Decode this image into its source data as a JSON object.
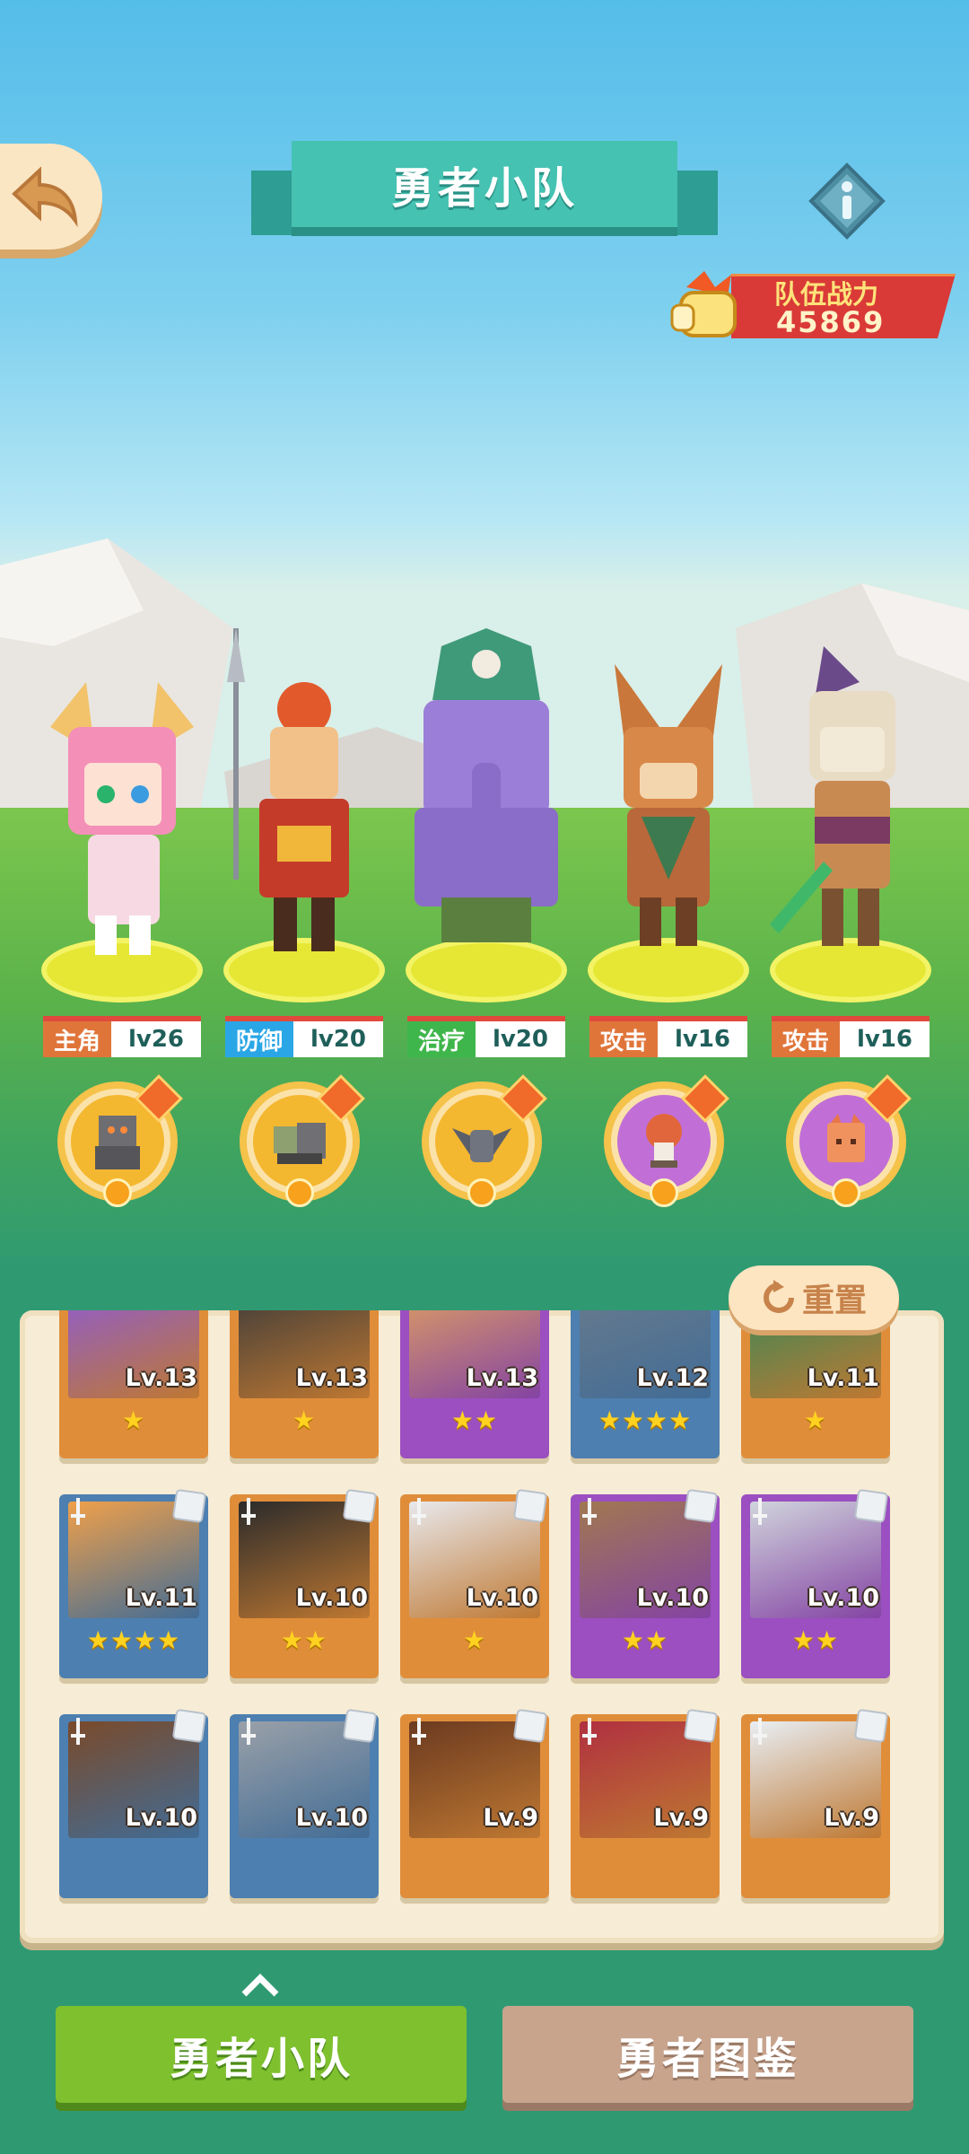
{
  "header": {
    "title": "勇者小队"
  },
  "team_power": {
    "label": "队伍战力",
    "value": "45869"
  },
  "heroes": [
    {
      "role": "主角",
      "level": "lv26",
      "role_color": "#e0753a"
    },
    {
      "role": "防御",
      "level": "lv20",
      "role_color": "#2aa6e6"
    },
    {
      "role": "治疗",
      "level": "lv20",
      "role_color": "#3fb64c"
    },
    {
      "role": "攻击",
      "level": "lv16",
      "role_color": "#e0753a"
    },
    {
      "role": "攻击",
      "level": "lv16",
      "role_color": "#e0753a"
    }
  ],
  "pets": [
    "robot-pet-icon",
    "tank-pet-icon",
    "bat-pet-icon",
    "mushroom-pet-icon",
    "block-pet-icon"
  ],
  "reset_label": "重置",
  "roster": [
    {
      "level": "Lv.13",
      "stars": "★",
      "color": "orange"
    },
    {
      "level": "Lv.13",
      "stars": "★",
      "color": "orange"
    },
    {
      "level": "Lv.13",
      "stars": "★★",
      "color": "purple"
    },
    {
      "level": "Lv.12",
      "stars": "★★★★",
      "color": "blue"
    },
    {
      "level": "Lv.11",
      "stars": "★",
      "color": "orange"
    },
    {
      "level": "Lv.11",
      "stars": "★★★★",
      "color": "blue"
    },
    {
      "level": "Lv.10",
      "stars": "★★",
      "color": "orange"
    },
    {
      "level": "Lv.10",
      "stars": "★",
      "color": "orange"
    },
    {
      "level": "Lv.10",
      "stars": "★★",
      "color": "purple"
    },
    {
      "level": "Lv.10",
      "stars": "★★",
      "color": "purple"
    },
    {
      "level": "Lv.10",
      "stars": "",
      "color": "blue"
    },
    {
      "level": "Lv.10",
      "stars": "",
      "color": "blue"
    },
    {
      "level": "Lv.9",
      "stars": "",
      "color": "orange"
    },
    {
      "level": "Lv.9",
      "stars": "",
      "color": "orange"
    },
    {
      "level": "Lv.9",
      "stars": "",
      "color": "orange"
    }
  ],
  "tabs": {
    "squad": "勇者小队",
    "codex": "勇者图鉴"
  }
}
